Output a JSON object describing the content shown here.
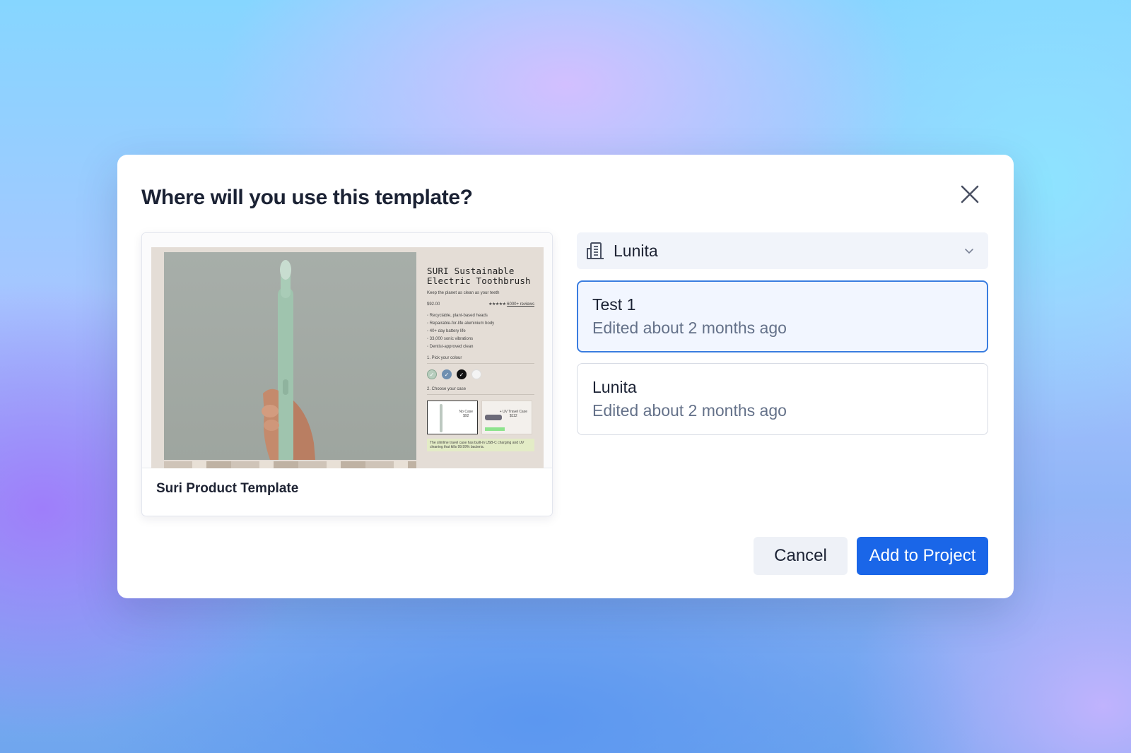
{
  "dialog": {
    "title": "Where will you use this template?",
    "close_icon": "close-icon"
  },
  "template": {
    "name": "Suri Product Template",
    "preview": {
      "product_title": "SURI Sustainable Electric Toothbrush",
      "tagline": "Keep the planet as clean as your teeth",
      "price": "$92.00",
      "stars": "★★★★★",
      "reviews": "6000+ reviews",
      "features": [
        "Recyclable, plant-based heads",
        "Repairable-for-life aluminium body",
        "40+ day battery life",
        "33,000 sonic vibrations",
        "Dentist-approved clean"
      ],
      "colour_section": "1. Pick your colour",
      "swatch_colors": [
        "#b7cdbd",
        "#6f8fb0",
        "#111111",
        "#f4f4f4"
      ],
      "case_section": "2. Choose your case",
      "cases": [
        {
          "label": "No Case",
          "price": "$92"
        },
        {
          "label": "+ UV Travel Case",
          "price": "$112",
          "tag": "MOST POPULAR"
        }
      ],
      "note": "The slimline travel case has built-in USB-C charging and UV cleaning that kills 99.99% bacteria."
    }
  },
  "organization": {
    "icon": "building-icon",
    "selected": "Lunita"
  },
  "projects": [
    {
      "name": "Test 1",
      "meta": "Edited about 2 months ago",
      "selected": true
    },
    {
      "name": "Lunita",
      "meta": "Edited about 2 months ago",
      "selected": false
    }
  ],
  "actions": {
    "cancel_label": "Cancel",
    "add_label": "Add to Project"
  },
  "colors": {
    "accent": "#1a66e8",
    "selected_border": "#3a7de0",
    "selected_bg": "#f2f6ff",
    "select_bg": "#f1f4fa"
  }
}
